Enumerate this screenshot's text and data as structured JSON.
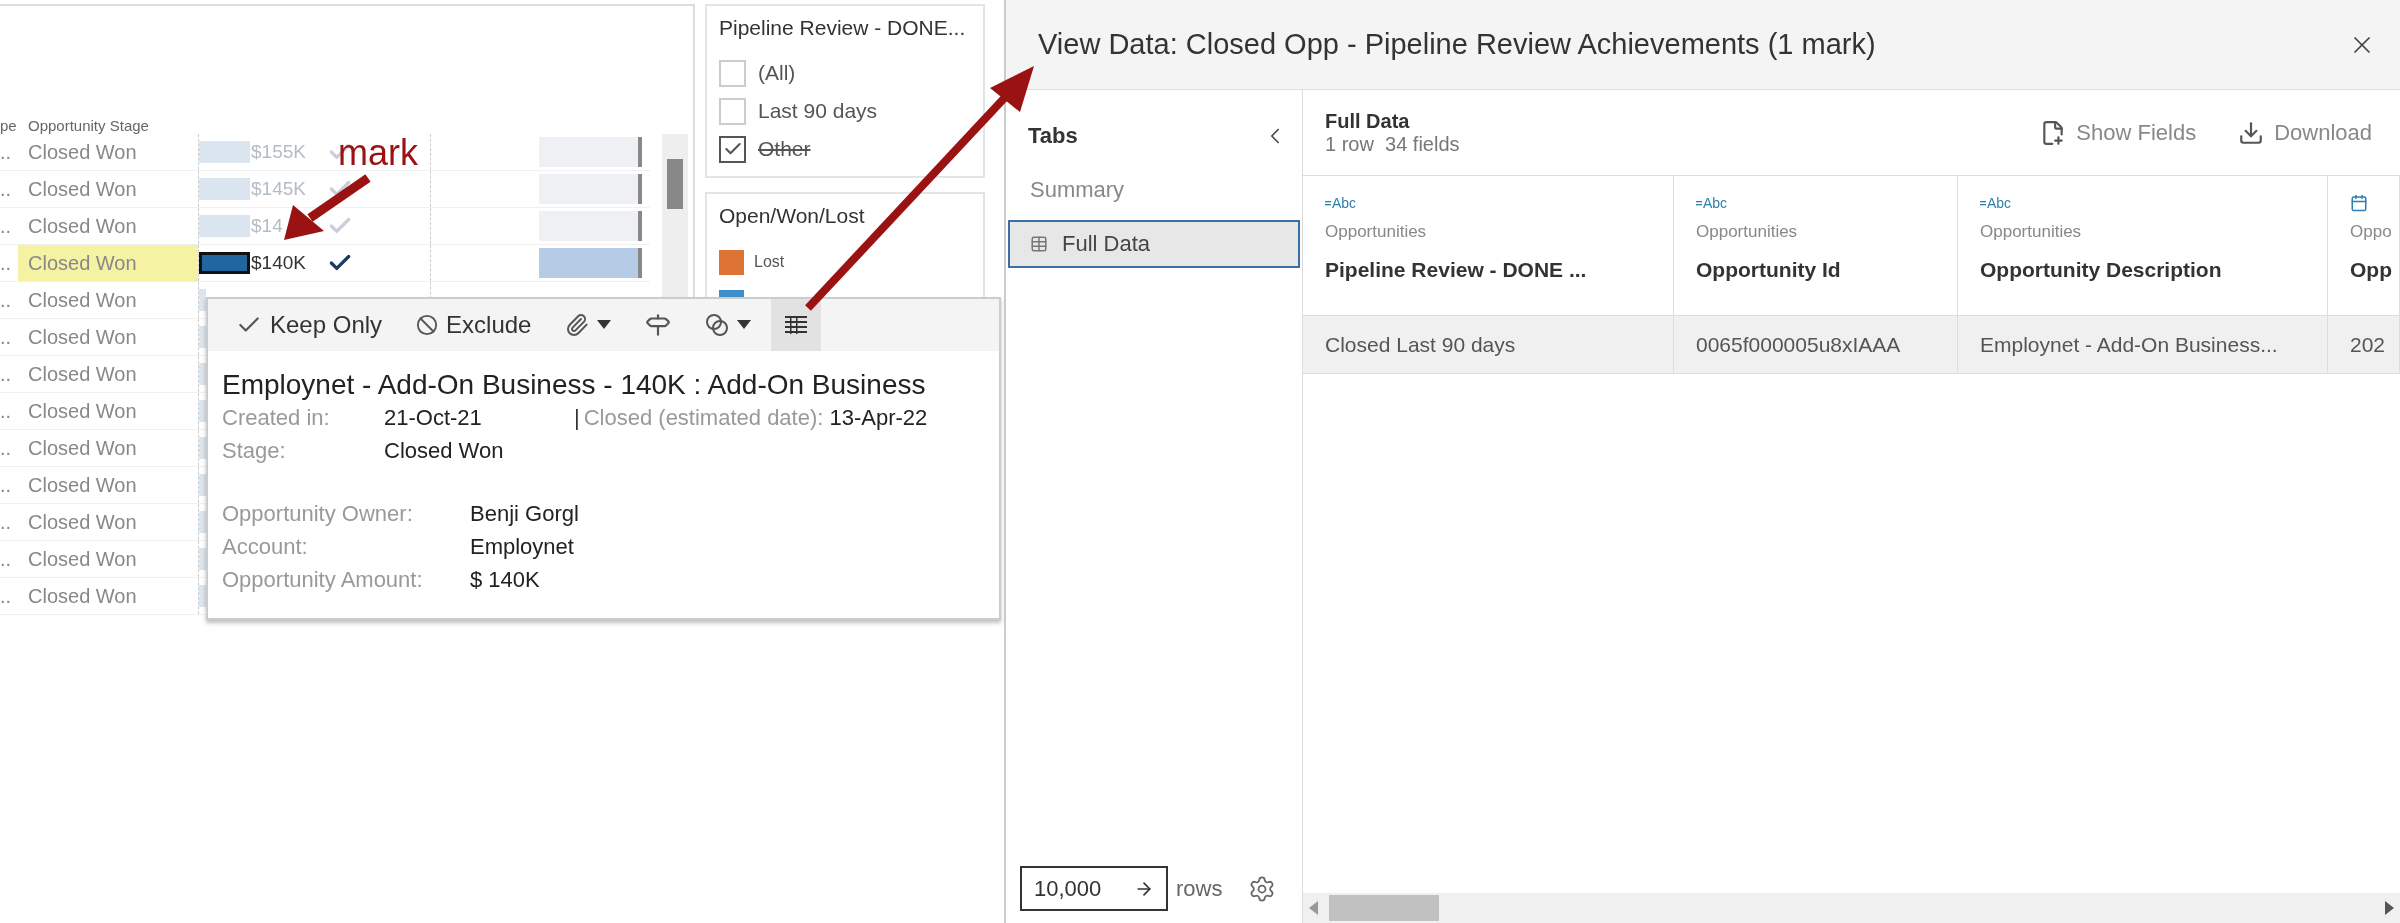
{
  "worksheet": {
    "header": [
      "pe",
      "Opportunity Stage"
    ],
    "rows": [
      {
        "col_1": "..",
        "stage": "Closed Won",
        "amount": "$155K",
        "checked": true,
        "selected": false,
        "level": 0.22
      },
      {
        "col_1": "..",
        "stage": "Closed Won",
        "amount": "$145K",
        "checked": true,
        "selected": false,
        "level": 0.22
      },
      {
        "col_1": "..",
        "stage": "Closed Won",
        "amount": "$14",
        "checked": true,
        "selected": false,
        "level": 0.22
      },
      {
        "col_1": "..",
        "stage": "Closed Won",
        "amount": "$140K",
        "checked": true,
        "selected": true,
        "level": 0.22
      },
      {
        "col_1": "..",
        "stage": "Closed Won",
        "selected": false
      },
      {
        "col_1": "..",
        "stage": "Closed Won",
        "selected": false
      },
      {
        "col_1": "..",
        "stage": "Closed Won",
        "selected": false
      },
      {
        "col_1": "..",
        "stage": "Closed Won",
        "selected": false
      },
      {
        "col_1": "..",
        "stage": "Closed Won",
        "selected": false
      },
      {
        "col_1": "..",
        "stage": "Closed Won",
        "selected": false
      },
      {
        "col_1": "..",
        "stage": "Closed Won",
        "selected": false
      },
      {
        "col_1": "..",
        "stage": "Closed Won",
        "selected": false
      },
      {
        "col_1": "..",
        "stage": "Closed Won",
        "selected": false
      }
    ]
  },
  "filter": {
    "title": "Pipeline Review - DONE...",
    "items": [
      {
        "label": "(All)",
        "checked": false,
        "excluded": false
      },
      {
        "label": "Last 90 days",
        "checked": false,
        "excluded": false
      },
      {
        "label": "Other",
        "checked": true,
        "excluded": true
      }
    ]
  },
  "legend": {
    "title": "Open/Won/Lost",
    "items": [
      {
        "label": "Lost",
        "color": "#dd7334"
      },
      {
        "color": "#3d8ec9"
      }
    ]
  },
  "annotation": {
    "label": "mark"
  },
  "tooltip": {
    "actions": [
      {
        "kind": "keep",
        "label": "Keep Only"
      },
      {
        "kind": "exclude",
        "label": "Exclude"
      },
      {
        "kind": "attach",
        "menu": true
      },
      {
        "kind": "sign"
      },
      {
        "kind": "group",
        "menu": true
      },
      {
        "kind": "view_data",
        "selected": true
      }
    ],
    "title": "Employnet - Add-On Business - 140K : Add-On Business",
    "created_label": "Created in:",
    "created": "21-Oct-21",
    "separator": "|",
    "closed_label": "Closed (estimated date):",
    "closed": "13-Apr-22",
    "stage_label": "Stage:",
    "stage": "Closed Won",
    "fields": [
      {
        "label": "Opportunity Owner:",
        "value": "Benji Gorgl"
      },
      {
        "label": "Account:",
        "value": "Employnet"
      },
      {
        "label": "Opportunity Amount:",
        "value": "$ 140K"
      }
    ]
  },
  "view_data": {
    "title": "View Data: Closed Opp - Pipeline Review Achievements (1 mark)",
    "sidebar": {
      "heading": "Tabs",
      "items": [
        {
          "label": "Summary",
          "selected": false
        },
        {
          "label": "Full Data",
          "selected": true
        }
      ],
      "rows_input": {
        "value": "10,000",
        "suffix": "rows"
      }
    },
    "main": {
      "title": "Full Data",
      "subtitle": "1 row  34 fields",
      "buttons": [
        {
          "kind": "show_fields",
          "label": "Show Fields"
        },
        {
          "kind": "download",
          "label": "Download"
        }
      ],
      "columns": [
        {
          "kind": "string",
          "type_text": "Abc",
          "source": "Opportunities",
          "name": "Pipeline Review - DONE ..."
        },
        {
          "kind": "string",
          "type_text": "Abc",
          "source": "Opportunities",
          "name": "Opportunity Id"
        },
        {
          "kind": "string",
          "type_text": "Abc",
          "source": "Opportunities",
          "name": "Opportunity Description"
        },
        {
          "kind": "date",
          "source": "Oppo",
          "name": "Opp"
        }
      ],
      "rows": [
        [
          "Closed Last 90 days",
          "0065f000005u8xIAAA",
          "Employnet - Add-On Business...",
          "202"
        ]
      ]
    }
  }
}
